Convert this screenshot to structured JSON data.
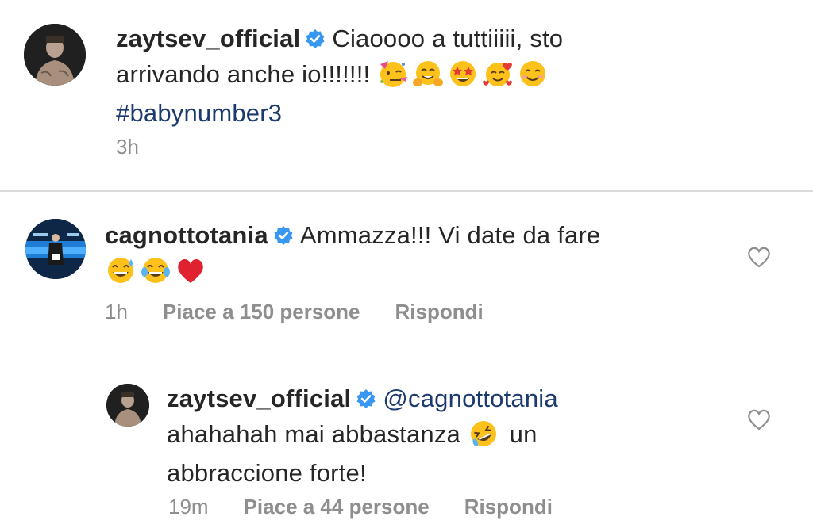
{
  "caption": {
    "username": "zaytsev_official",
    "line1_text": "Ciaoooo a tuttiiiii, sto",
    "line2_text": "arrivando anche io!!!!!!!",
    "hashtag": "#babynumber3",
    "time": "3h",
    "emojis": [
      "partying-face-emoji",
      "hugging-face-emoji",
      "star-struck-emoji",
      "smiling-face-with-hearts-emoji",
      "smiling-face-emoji"
    ]
  },
  "comments": [
    {
      "username": "cagnottotania",
      "line1_text": "Ammazza!!! Vi date da fare",
      "time": "1h",
      "likes": "Piace a 150 persone",
      "reply": "Rispondi",
      "emojis": [
        "grinning-sweat-emoji",
        "tears-of-joy-emoji",
        "red-heart-emoji"
      ]
    },
    {
      "username": "zaytsev_official",
      "mention": "@cagnottotania",
      "line2_before": "ahahahah mai abbastanza",
      "line2_after": "un",
      "line3_text": "abbraccione forte!",
      "time": "19m",
      "likes": "Piace a 44 persone",
      "reply": "Rispondi",
      "emojis": [
        "rolling-laughing-emoji"
      ]
    }
  ],
  "colors": {
    "link_blue": "#1d3a6e",
    "verified_blue": "#3897f0",
    "muted_gray": "#8e8e8e",
    "divider": "#dbdbdb"
  }
}
